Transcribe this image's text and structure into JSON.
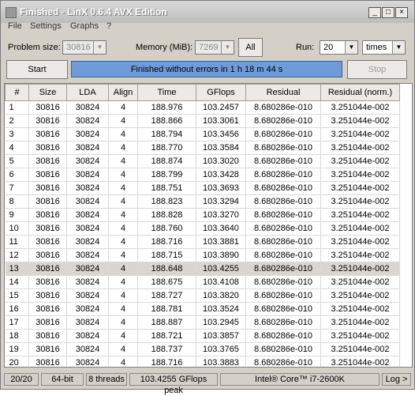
{
  "window": {
    "title": "Finished - LinX 0.6.4 AVX Edition",
    "controls": [
      "_",
      "□",
      "×"
    ]
  },
  "menu": [
    "File",
    "Settings",
    "Graphs",
    "?"
  ],
  "toolbar": {
    "problem_size_label": "Problem size:",
    "problem_size_value": "30816",
    "memory_label": "Memory (MiB):",
    "memory_value": "7269",
    "all_label": "All",
    "run_label": "Run:",
    "run_value": "20",
    "run_unit": "times",
    "start_label": "Start",
    "status_text": "Finished without errors in 1 h 18 m 44 s",
    "stop_label": "Stop"
  },
  "table": {
    "headers": [
      "#",
      "Size",
      "LDA",
      "Align",
      "Time",
      "GFlops",
      "Residual",
      "Residual (norm.)"
    ],
    "selected_row": 13,
    "rows": [
      [
        "1",
        "30816",
        "30824",
        "4",
        "188.976",
        "103.2457",
        "8.680286e-010",
        "3.251044e-002"
      ],
      [
        "2",
        "30816",
        "30824",
        "4",
        "188.866",
        "103.3061",
        "8.680286e-010",
        "3.251044e-002"
      ],
      [
        "3",
        "30816",
        "30824",
        "4",
        "188.794",
        "103.3456",
        "8.680286e-010",
        "3.251044e-002"
      ],
      [
        "4",
        "30816",
        "30824",
        "4",
        "188.770",
        "103.3584",
        "8.680286e-010",
        "3.251044e-002"
      ],
      [
        "5",
        "30816",
        "30824",
        "4",
        "188.874",
        "103.3020",
        "8.680286e-010",
        "3.251044e-002"
      ],
      [
        "6",
        "30816",
        "30824",
        "4",
        "188.799",
        "103.3428",
        "8.680286e-010",
        "3.251044e-002"
      ],
      [
        "7",
        "30816",
        "30824",
        "4",
        "188.751",
        "103.3693",
        "8.680286e-010",
        "3.251044e-002"
      ],
      [
        "8",
        "30816",
        "30824",
        "4",
        "188.823",
        "103.3294",
        "8.680286e-010",
        "3.251044e-002"
      ],
      [
        "9",
        "30816",
        "30824",
        "4",
        "188.828",
        "103.3270",
        "8.680286e-010",
        "3.251044e-002"
      ],
      [
        "10",
        "30816",
        "30824",
        "4",
        "188.760",
        "103.3640",
        "8.680286e-010",
        "3.251044e-002"
      ],
      [
        "11",
        "30816",
        "30824",
        "4",
        "188.716",
        "103.3881",
        "8.680286e-010",
        "3.251044e-002"
      ],
      [
        "12",
        "30816",
        "30824",
        "4",
        "188.715",
        "103.3890",
        "8.680286e-010",
        "3.251044e-002"
      ],
      [
        "13",
        "30816",
        "30824",
        "4",
        "188.648",
        "103.4255",
        "8.680286e-010",
        "3.251044e-002"
      ],
      [
        "14",
        "30816",
        "30824",
        "4",
        "188.675",
        "103.4108",
        "8.680286e-010",
        "3.251044e-002"
      ],
      [
        "15",
        "30816",
        "30824",
        "4",
        "188.727",
        "103.3820",
        "8.680286e-010",
        "3.251044e-002"
      ],
      [
        "16",
        "30816",
        "30824",
        "4",
        "188.781",
        "103.3524",
        "8.680286e-010",
        "3.251044e-002"
      ],
      [
        "17",
        "30816",
        "30824",
        "4",
        "188.887",
        "103.2945",
        "8.680286e-010",
        "3.251044e-002"
      ],
      [
        "18",
        "30816",
        "30824",
        "4",
        "188.721",
        "103.3857",
        "8.680286e-010",
        "3.251044e-002"
      ],
      [
        "19",
        "30816",
        "30824",
        "4",
        "188.737",
        "103.3765",
        "8.680286e-010",
        "3.251044e-002"
      ],
      [
        "20",
        "30816",
        "30824",
        "4",
        "188.716",
        "103.3883",
        "8.680286e-010",
        "3.251044e-002"
      ]
    ]
  },
  "statusbar": {
    "runs": "20/20",
    "arch": "64-bit",
    "threads": "8 threads",
    "peak": "103.4255 GFlops peak",
    "cpu": "Intel® Core™ i7-2600K",
    "log": "Log >"
  }
}
